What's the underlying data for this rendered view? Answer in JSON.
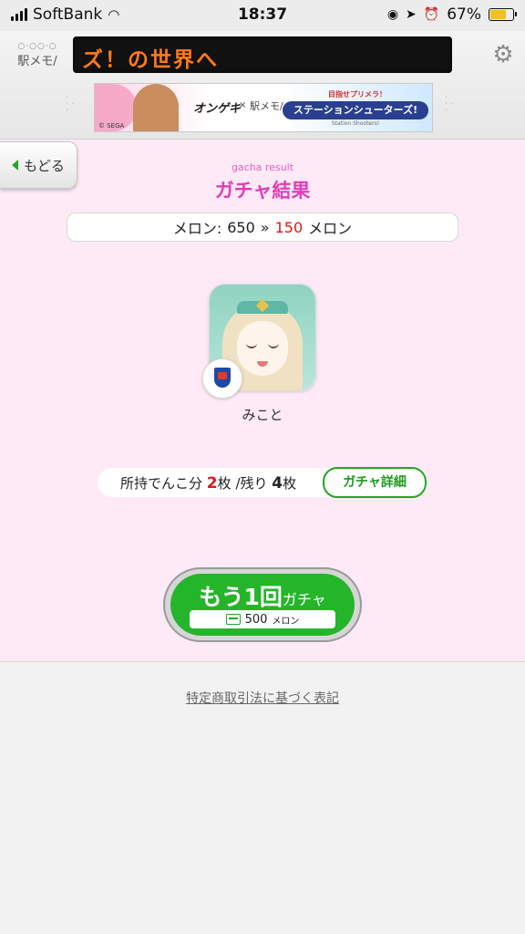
{
  "status_bar": {
    "carrier": "SoftBank",
    "time": "18:37",
    "battery": "67%"
  },
  "header": {
    "logo_text": "駅メモ/",
    "ticker_text": "ズ！の世界へ",
    "banner": {
      "left_text": "オンゲキ",
      "cross": "×",
      "right_text": "駅メモ/",
      "badge_top": "目指せプリメラ！",
      "badge_main": "ステーションシューターズ!",
      "badge_sub": "Station Shooters!",
      "sega": "© SEGA"
    }
  },
  "back_button": {
    "label": "もどる"
  },
  "result": {
    "subtitle": "gacha result",
    "title": "ガチャ結果",
    "currency_label": "メロン:",
    "currency_before": "650",
    "arrow": "»",
    "currency_after": "150",
    "currency_unit": "メロン"
  },
  "character": {
    "name": "みこと"
  },
  "inventory": {
    "prefix": "所持でんこ分",
    "owned": "2",
    "owned_unit": "枚",
    "remaining_label": "/残り",
    "remaining": "4",
    "remaining_unit": "枚",
    "detail_button": "ガチャ詳細"
  },
  "again_button": {
    "main": "もう1回",
    "sub": "ガチャ",
    "cost_value": "500",
    "cost_unit": "メロン"
  },
  "footer": {
    "legal_link": "特定商取引法に基づく表記"
  },
  "colors": {
    "accent_pink": "#e03eb8",
    "main_bg": "#fdeaf6",
    "green": "#25b52a",
    "red": "#e21515"
  }
}
